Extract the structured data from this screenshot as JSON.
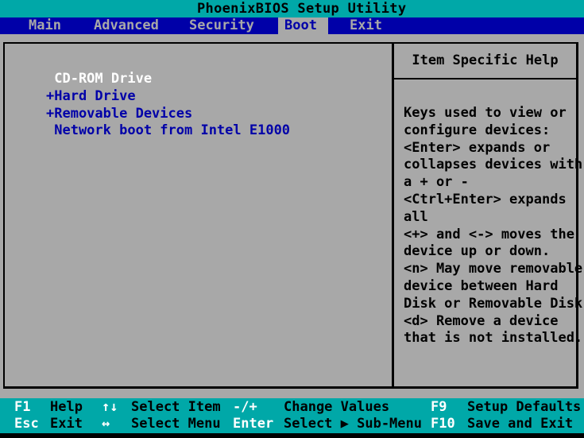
{
  "window": {
    "title": "PhoenixBIOS Setup Utility"
  },
  "menu": {
    "items": [
      {
        "label": "Main",
        "active": false
      },
      {
        "label": "Advanced",
        "active": false
      },
      {
        "label": "Security",
        "active": false
      },
      {
        "label": "Boot",
        "active": true
      },
      {
        "label": "Exit",
        "active": false
      }
    ]
  },
  "boot_list": {
    "items": [
      {
        "label": " CD-ROM Drive",
        "selected": true
      },
      {
        "label": "+Hard Drive",
        "selected": false
      },
      {
        "label": "+Removable Devices",
        "selected": false
      },
      {
        "label": " Network boot from Intel E1000",
        "selected": false
      }
    ]
  },
  "help_panel": {
    "title": "Item Specific Help",
    "text": "Keys used to view or\nconfigure devices:\n<Enter> expands or\ncollapses devices with\na + or -\n<Ctrl+Enter> expands\nall\n<+> and <-> moves the\ndevice up or down.\n<n> May move removable\ndevice between Hard\nDisk or Removable Disk\n<d> Remove a device\nthat is not installed."
  },
  "footer": {
    "row1": [
      {
        "key": "F1",
        "desc": "Help"
      },
      {
        "key": "↑↓",
        "desc": "Select Item"
      },
      {
        "key": "-/+",
        "desc": "Change Values"
      },
      {
        "key": "F9",
        "desc": "Setup Defaults"
      }
    ],
    "row2": [
      {
        "key": "Esc",
        "desc": "Exit"
      },
      {
        "key": "↔",
        "desc": "Select Menu"
      },
      {
        "key": "Enter",
        "desc": "Select ▶ Sub-Menu"
      },
      {
        "key": "F10",
        "desc": "Save and Exit"
      }
    ]
  },
  "colors": {
    "background": "#a8a8a8",
    "title_bar": "#00a8a8",
    "menu_bar": "#0000a8",
    "footer": "#00a8a8",
    "item_text": "#0000a8",
    "selected_text": "#ffffff"
  }
}
